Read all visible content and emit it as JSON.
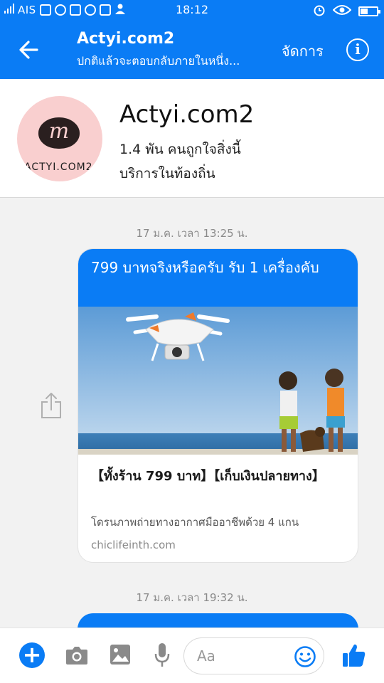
{
  "status_bar": {
    "carrier": "AIS",
    "time": "18:12",
    "battery_level": 0.45
  },
  "header": {
    "back_icon": "arrow-left-icon",
    "title": "Actyi.com2",
    "subtitle": "ปกติแล้วจะตอบกลับภายในหนึ่ง...",
    "manage_label": "จัดการ",
    "info_icon": "info-icon"
  },
  "page": {
    "name": "Actyi.com2",
    "likes": "1.4 พัน คนถูกใจสิ่งนี้",
    "category": "บริการในท้องถิ่น",
    "avatar_mark": "m",
    "avatar_brand": "ACTYI.COM2",
    "avatar_color": "#f9cfcf"
  },
  "conversation": {
    "timestamp_1": "17 ม.ค. เวลา 13:25 น.",
    "message_1": {
      "text": "799 บาทจริงหรือครับ รับ 1 เครื่องคับ",
      "link_title": "【ทั้งร้าน 799 บาท】【เก็บเงินปลายทาง】",
      "link_description": "โดรนภาพถ่ายทางอากาศมืออาชีพด้วย 4 แกน",
      "link_domain": "chiclifeinth.com"
    },
    "timestamp_2": "17 ม.ค. เวลา 19:32 น."
  },
  "composer": {
    "placeholder": "Aa",
    "icons": [
      "plus-icon",
      "camera-icon",
      "image-icon",
      "microphone-icon",
      "emoji-icon",
      "thumbs-up-icon"
    ]
  },
  "colors": {
    "accent": "#0a7cf5",
    "background": "#f2f2f2"
  }
}
